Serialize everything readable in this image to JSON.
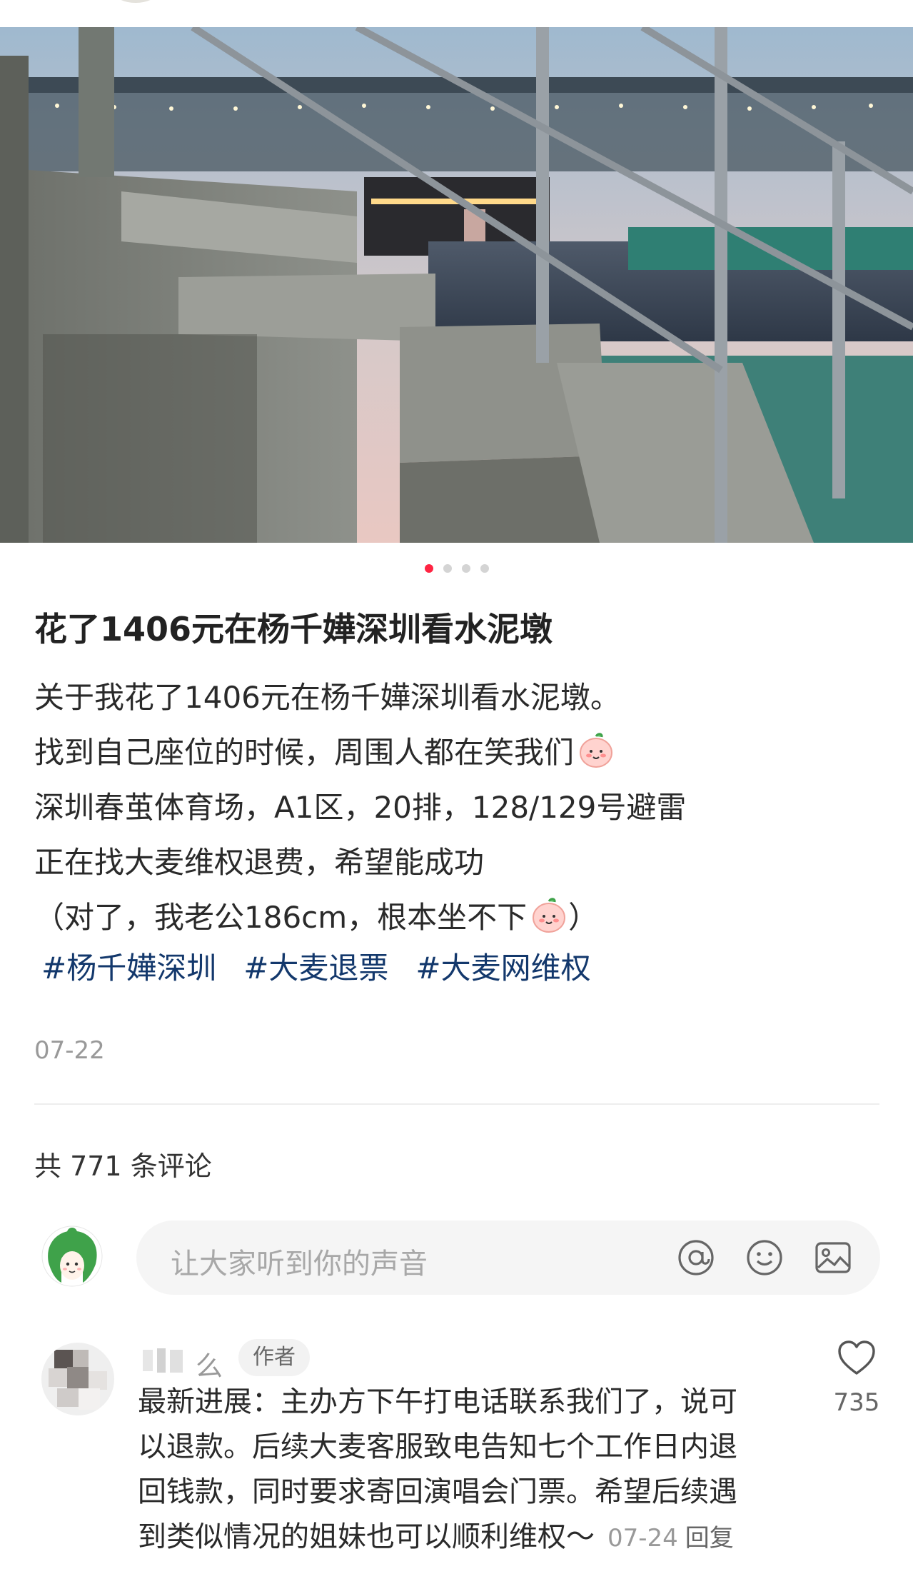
{
  "post": {
    "carousel": {
      "total": 4,
      "active": 1
    },
    "title": "花了1406元在杨千嬅深圳看水泥墩",
    "body_lines": [
      "关于我花了1406元在杨千嬅深圳看水泥墩。",
      "找到自己座位的时候，周围人都在笑我们",
      "深圳春茧体育场，A1区，20排，128/129号避雷",
      "正在找大麦维权退费，希望能成功",
      "（对了，我老公186cm，根本坐不下",
      "）"
    ],
    "tags": [
      "#杨千嬅深圳",
      "#大麦退票",
      "#大麦网维权"
    ],
    "date": "07-22"
  },
  "comments_section": {
    "count_label": "共 771 条评论",
    "input_placeholder": "让大家听到你的声音",
    "input_icons": [
      "at-icon",
      "emoji-icon",
      "image-icon"
    ]
  },
  "comments": [
    {
      "username_visible": "么",
      "badge": "作者",
      "text_lines": [
        "最新进展：主办方下午打电话联系我们了，说可",
        "以退款。后续大麦客服致电告知七个工作日内退",
        "回钱款，同时要求寄回演唱会门票。希望后续遇",
        "到类似情况的姐妹也可以顺利维权～"
      ],
      "date": "07-24",
      "reply_label": "回复",
      "likes": "735"
    }
  ],
  "colors": {
    "accent": "#ff2442",
    "tag": "#13386c",
    "muted": "#999999"
  }
}
